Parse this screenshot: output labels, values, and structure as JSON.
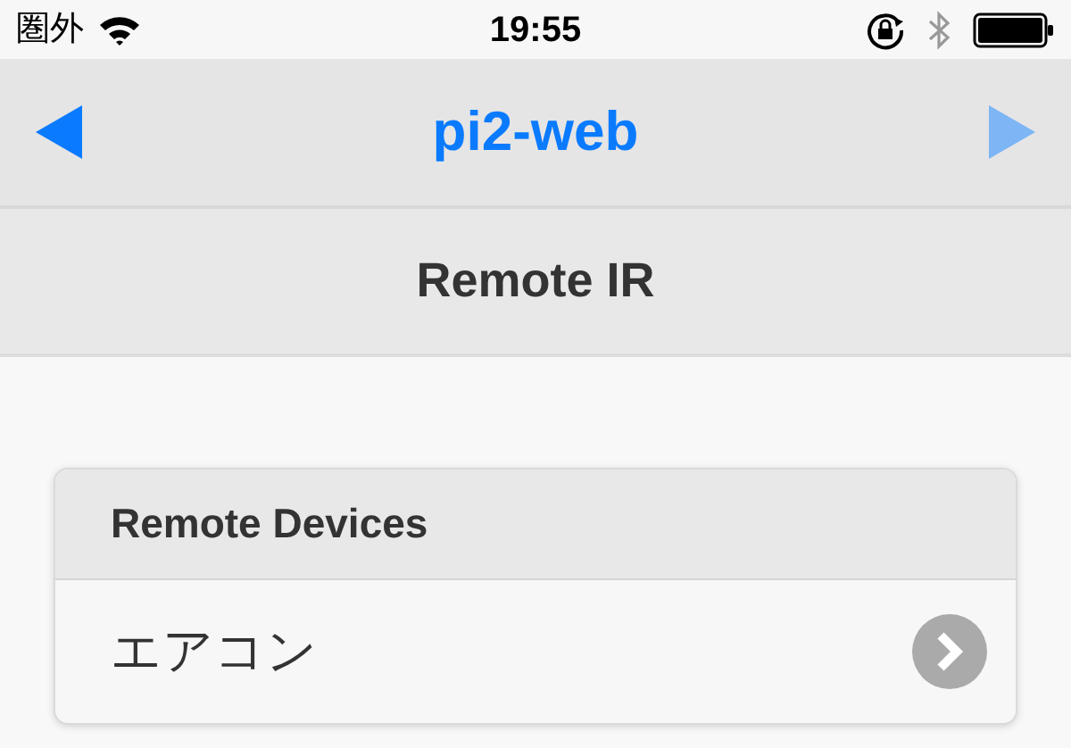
{
  "status_bar": {
    "carrier": "圏外",
    "time": "19:55"
  },
  "nav_bar": {
    "title": "pi2-web",
    "back": {
      "disabled": false
    },
    "forward": {
      "disabled": true
    }
  },
  "header": {
    "title": "Remote IR"
  },
  "list": {
    "title": "Remote Devices",
    "items": [
      {
        "label": "エアコン"
      }
    ]
  }
}
